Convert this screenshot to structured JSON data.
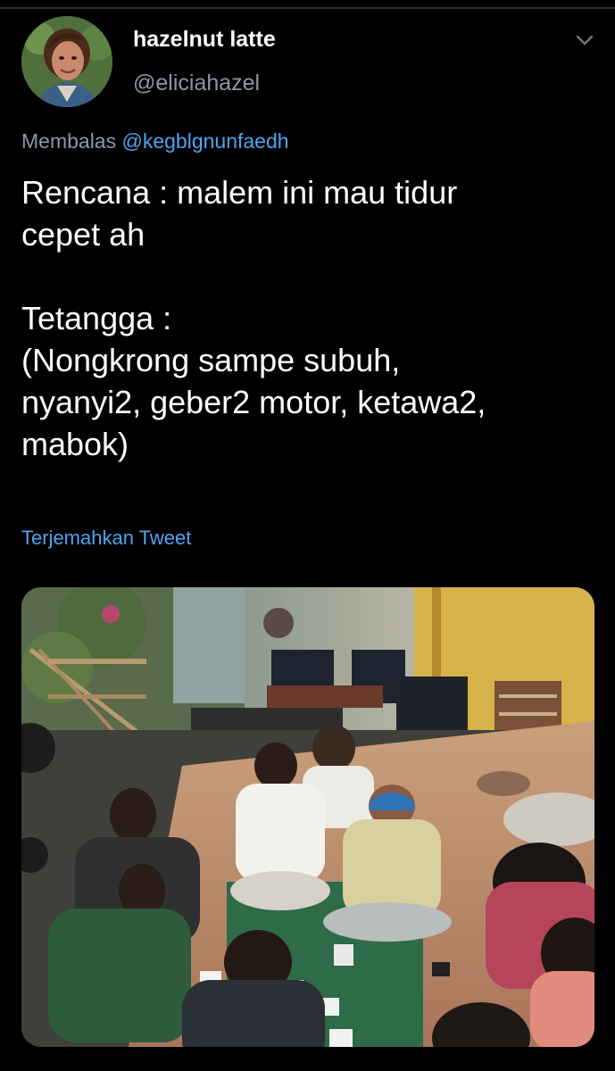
{
  "tweet": {
    "display_name": "hazelnut latte",
    "handle": "@eliciahazel",
    "reply_prefix": "Membalas",
    "reply_mention": "@kegblgnunfaedh",
    "text": "Rencana : malem ini mau tidur\ncepet ah\n\nTetangga :\n(Nongkrong sampe subuh,\nnyanyi2, geber2 motor, ketawa2,\nmabok)",
    "translate_label": "Terjemahkan Tweet"
  },
  "icons": {
    "menu": "chevron-down-icon"
  },
  "colors": {
    "background": "#000000",
    "link": "#4ea4f1",
    "secondary_text": "#8b98a5",
    "primary_text": "#ffffff"
  }
}
